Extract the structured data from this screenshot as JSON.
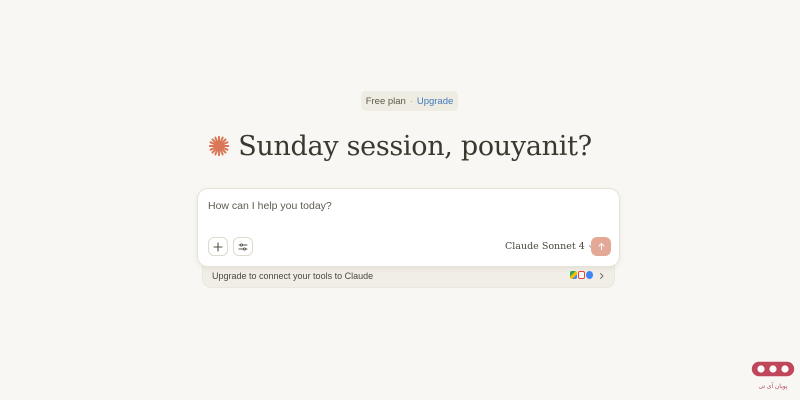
{
  "plan": {
    "label": "Free plan",
    "separator": "·",
    "upgrade": "Upgrade"
  },
  "greeting": {
    "icon": "claude-spark-icon",
    "text": "Sunday session, pouyanit?",
    "accent_color": "#d97757"
  },
  "composer": {
    "placeholder": "How can I help you today?",
    "add_icon": "plus-icon",
    "tools_icon": "sliders-icon",
    "model": "Claude Sonnet 4",
    "model_icon": "chevron-down-icon",
    "send_icon": "arrow-up-icon",
    "send_color": "#e3a896"
  },
  "tools_banner": {
    "text": "Upgrade to connect your tools to Claude",
    "icons": [
      "drive-icon",
      "gmail-icon",
      "calendar-icon"
    ],
    "chevron": "chevron-right-icon"
  },
  "watermark": {
    "text": "پویان آی تی"
  }
}
